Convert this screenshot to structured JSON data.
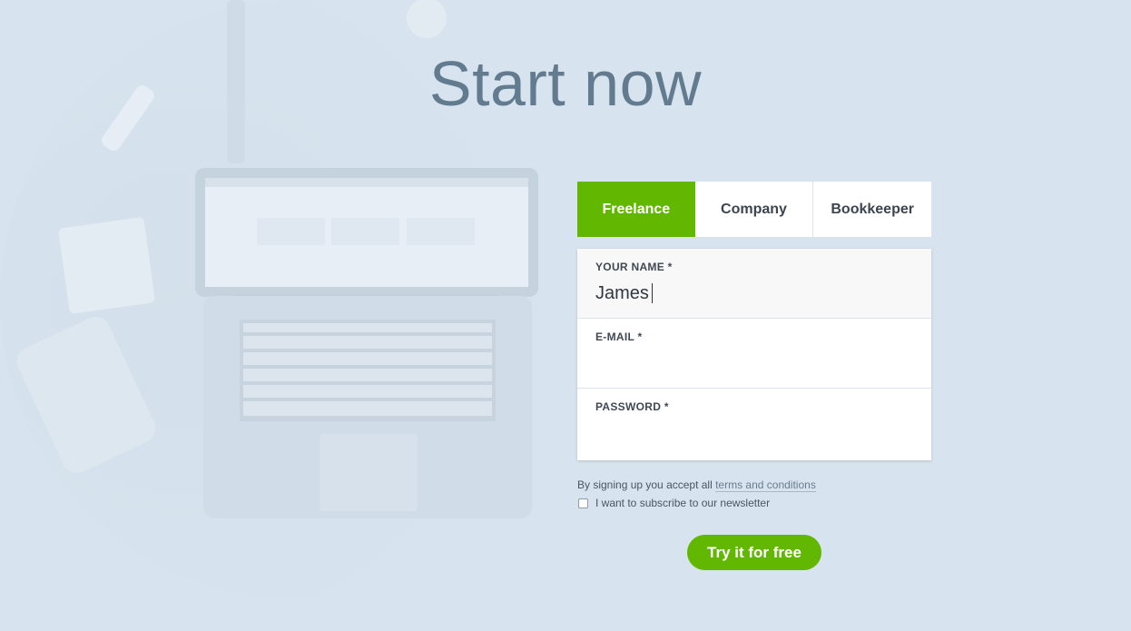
{
  "page": {
    "title": "Start now"
  },
  "tabs": [
    {
      "label": "Freelance",
      "active": true
    },
    {
      "label": "Company",
      "active": false
    },
    {
      "label": "Bookkeeper",
      "active": false
    }
  ],
  "form": {
    "name": {
      "label": "YOUR NAME *",
      "value": "James"
    },
    "email": {
      "label": "E-MAIL *",
      "value": ""
    },
    "password": {
      "label": "PASSWORD *",
      "value": ""
    }
  },
  "terms": {
    "text": "By signing up you accept all ",
    "link": "terms and conditions"
  },
  "newsletter": {
    "label": "I want to subscribe to our newsletter",
    "checked": false
  },
  "cta": {
    "label": "Try it for free"
  },
  "colors": {
    "accent": "#62b800",
    "title": "#627b8f",
    "background": "#d7e3ee"
  },
  "background_image": {
    "icon": "laptop-desk-photo-icon"
  }
}
